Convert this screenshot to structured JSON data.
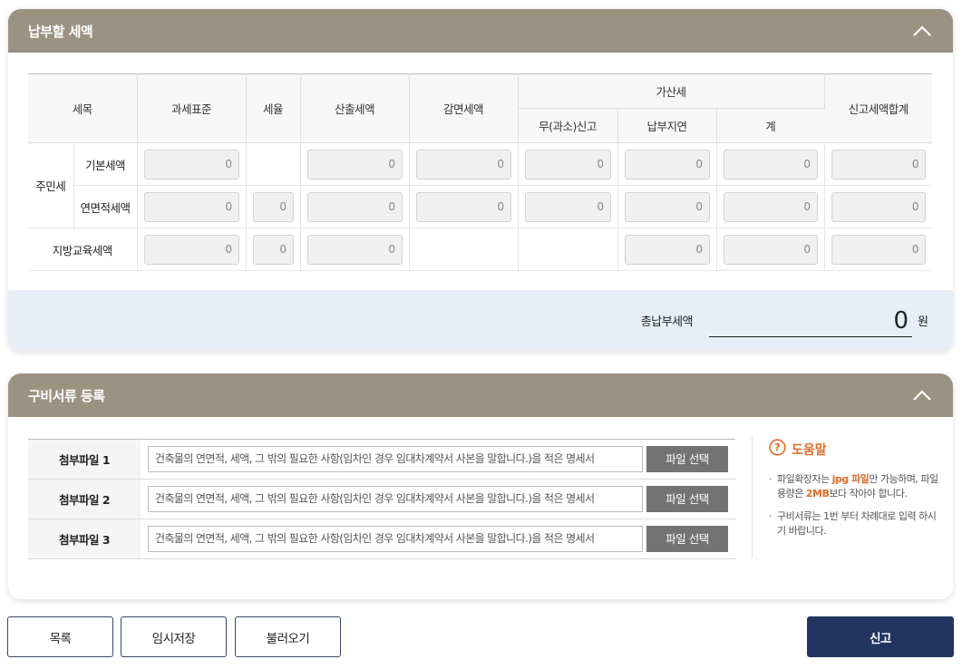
{
  "tax_section": {
    "title": "납부할 세액",
    "headers": {
      "item": "세목",
      "tax_base": "과세표준",
      "tax_rate": "세율",
      "calculated_tax": "산출세액",
      "reduction_tax": "감면세액",
      "additional_tax": "가산세",
      "no_report": "무(과소)신고",
      "late_payment": "납부지연",
      "subtotal": "계",
      "total_reported": "신고세액합계"
    },
    "rows": {
      "resident_tax": "주민세",
      "basic_tax": "기본세액",
      "area_tax": "연면적세액",
      "local_edu_tax": "지방교육세액"
    },
    "zero": "0",
    "total_label": "총납부세액",
    "total_value": "0",
    "total_unit": "원"
  },
  "docs_section": {
    "title": "구비서류 등록",
    "files": [
      {
        "label": "첨부파일 1",
        "placeholder": "건축물의 연면적, 세액, 그 밖의 필요한 사항(임차인 경우 임대차계약서 사본을 말합니다.)을 적은 명세서",
        "button": "파일 선택"
      },
      {
        "label": "첨부파일 2",
        "placeholder": "건축물의 연면적, 세액, 그 밖의 필요한 사항(임차인 경우 임대차계약서 사본을 말합니다.)을 적은 명세서",
        "button": "파일 선택"
      },
      {
        "label": "첨부파일 3",
        "placeholder": "건축물의 연면적, 세액, 그 밖의 필요한 사항(임차인 경우 임대차계약서 사본을 말합니다.)을 적은 명세서",
        "button": "파일 선택"
      }
    ],
    "help": {
      "title": "도움말",
      "item1_a": "파일확장자는 ",
      "item1_b": "jpg 파일",
      "item1_c": "만 가능하며, 파일용량은 ",
      "item1_d": "2MB",
      "item1_e": "보다 작아야 합니다.",
      "item2": "구비서류는 1번 부터 차례대로 입력 하시기 바랍니다."
    }
  },
  "buttons": {
    "list": "목록",
    "temp_save": "임시저장",
    "load": "불러오기",
    "submit": "신고"
  },
  "colors": {
    "header_bg": "#9c9282",
    "total_bg": "#e6eef7",
    "accent": "#e06a2a",
    "primary": "#223561"
  }
}
